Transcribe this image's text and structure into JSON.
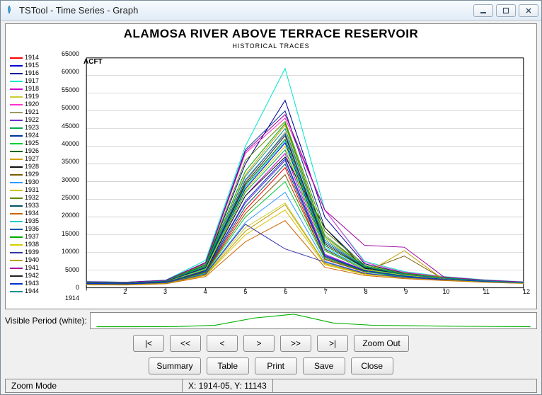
{
  "window": {
    "title": "TSTool - Time Series - Graph",
    "min_tip": "Minimize",
    "max_tip": "Restore",
    "close_tip": "Close"
  },
  "chart": {
    "title": "ALAMOSA RIVER ABOVE TERRACE RESERVOIR",
    "subtitle": "HISTORICAL TRACES",
    "y_unit": "ACFT",
    "origin_label": "1914",
    "ylim": [
      0,
      65000
    ],
    "xlim": [
      1,
      12
    ]
  },
  "y_ticks": [
    "65000",
    "60000",
    "55000",
    "50000",
    "45000",
    "40000",
    "35000",
    "30000",
    "25000",
    "20000",
    "15000",
    "10000",
    "5000",
    "0"
  ],
  "x_ticks": [
    "2",
    "3",
    "4",
    "5",
    "6",
    "7",
    "8",
    "9",
    "10",
    "11",
    "12"
  ],
  "legend": [
    {
      "label": "1914",
      "color": "#ff0000"
    },
    {
      "label": "1915",
      "color": "#0000cc"
    },
    {
      "label": "1916",
      "color": "#000099"
    },
    {
      "label": "1917",
      "color": "#00e6cc"
    },
    {
      "label": "1918",
      "color": "#cc00cc"
    },
    {
      "label": "1919",
      "color": "#cccc33"
    },
    {
      "label": "1920",
      "color": "#ff33cc"
    },
    {
      "label": "1921",
      "color": "#999966"
    },
    {
      "label": "1922",
      "color": "#6633cc"
    },
    {
      "label": "1923",
      "color": "#00aa55"
    },
    {
      "label": "1924",
      "color": "#003399"
    },
    {
      "label": "1925",
      "color": "#00cc33"
    },
    {
      "label": "1926",
      "color": "#006600"
    },
    {
      "label": "1927",
      "color": "#d4a000"
    },
    {
      "label": "1928",
      "color": "#111111"
    },
    {
      "label": "1929",
      "color": "#7a5c00"
    },
    {
      "label": "1930",
      "color": "#3399ff"
    },
    {
      "label": "1931",
      "color": "#d4c200"
    },
    {
      "label": "1932",
      "color": "#5c8a00"
    },
    {
      "label": "1933",
      "color": "#005566"
    },
    {
      "label": "1934",
      "color": "#cc6600"
    },
    {
      "label": "1935",
      "color": "#00d0d0"
    },
    {
      "label": "1936",
      "color": "#0055aa"
    },
    {
      "label": "1937",
      "color": "#00aa00"
    },
    {
      "label": "1938",
      "color": "#d0d000"
    },
    {
      "label": "1939",
      "color": "#3333aa"
    },
    {
      "label": "1940",
      "color": "#bca000"
    },
    {
      "label": "1941",
      "color": "#a000a0"
    },
    {
      "label": "1942",
      "color": "#222222"
    },
    {
      "label": "1943",
      "color": "#0033cc"
    },
    {
      "label": "1944",
      "color": "#009090"
    }
  ],
  "chart_data": {
    "type": "line",
    "xlabel": "",
    "ylabel": "ACFT",
    "xlim": [
      1,
      12
    ],
    "ylim": [
      0,
      65000
    ],
    "x": [
      1,
      2,
      3,
      4,
      5,
      6,
      7,
      8,
      9,
      10,
      11,
      12
    ],
    "series": [
      {
        "name": "1914",
        "values": [
          1200,
          1100,
          1500,
          4500,
          22000,
          34000,
          8000,
          4500,
          3200,
          2400,
          1800,
          1400
        ]
      },
      {
        "name": "1915",
        "values": [
          1400,
          1300,
          1700,
          5200,
          28000,
          41000,
          11000,
          5200,
          3600,
          2600,
          1900,
          1500
        ]
      },
      {
        "name": "1916",
        "values": [
          1600,
          1500,
          2000,
          6500,
          35000,
          53000,
          20000,
          6800,
          4200,
          3000,
          2100,
          1600
        ]
      },
      {
        "name": "1917",
        "values": [
          1800,
          1600,
          2200,
          7800,
          40000,
          62000,
          22000,
          7500,
          4600,
          3200,
          2300,
          1700
        ]
      },
      {
        "name": "1918",
        "values": [
          1300,
          1200,
          1600,
          5000,
          26000,
          38000,
          9500,
          5000,
          3400,
          2500,
          1850,
          1450
        ]
      },
      {
        "name": "1919",
        "values": [
          1000,
          950,
          1300,
          3800,
          17000,
          24000,
          7000,
          4000,
          2900,
          2200,
          1650,
          1300
        ]
      },
      {
        "name": "1920",
        "values": [
          1700,
          1550,
          2100,
          7000,
          38000,
          48000,
          22000,
          7200,
          4400,
          3100,
          2200,
          1650
        ]
      },
      {
        "name": "1921",
        "values": [
          1500,
          1400,
          1900,
          6000,
          30000,
          44000,
          15000,
          6000,
          3900,
          2800,
          2000,
          1550
        ]
      },
      {
        "name": "1922",
        "values": [
          1250,
          1150,
          1550,
          4800,
          24000,
          36000,
          9000,
          4800,
          3300,
          2450,
          1800,
          1420
        ]
      },
      {
        "name": "1923",
        "values": [
          1350,
          1250,
          1650,
          5100,
          27000,
          39000,
          10500,
          5100,
          3500,
          2550,
          1870,
          1470
        ]
      },
      {
        "name": "1924",
        "values": [
          1750,
          1600,
          2150,
          7200,
          39000,
          50000,
          17000,
          6200,
          3950,
          2850,
          2050,
          1580
        ]
      },
      {
        "name": "1925",
        "values": [
          1100,
          1000,
          1400,
          4200,
          20000,
          30000,
          8200,
          4600,
          3100,
          2350,
          1750,
          1370
        ]
      },
      {
        "name": "1926",
        "values": [
          1450,
          1350,
          1800,
          5600,
          29000,
          42000,
          12000,
          5600,
          3750,
          2700,
          1950,
          1520
        ]
      },
      {
        "name": "1927",
        "values": [
          1550,
          1450,
          1950,
          6200,
          32000,
          46000,
          14000,
          6100,
          3850,
          2750,
          1980,
          1540
        ]
      },
      {
        "name": "1928",
        "values": [
          1300,
          1200,
          1600,
          5000,
          26000,
          37000,
          17000,
          5500,
          3700,
          2650,
          1900,
          1480
        ]
      },
      {
        "name": "1929",
        "values": [
          1150,
          1050,
          1450,
          4400,
          21000,
          32000,
          8500,
          4700,
          9000,
          2400,
          1780,
          1400
        ]
      },
      {
        "name": "1930",
        "values": [
          1050,
          980,
          1350,
          4000,
          18500,
          27000,
          7500,
          4200,
          3000,
          2300,
          1700,
          1340
        ]
      },
      {
        "name": "1931",
        "values": [
          900,
          850,
          1200,
          3500,
          15000,
          22000,
          6500,
          3800,
          2800,
          2150,
          1620,
          1280
        ]
      },
      {
        "name": "1932",
        "values": [
          1650,
          1500,
          2050,
          6800,
          36000,
          47000,
          16000,
          6500,
          4100,
          2950,
          2120,
          1620
        ]
      },
      {
        "name": "1933",
        "values": [
          1200,
          1100,
          1500,
          4600,
          23000,
          35000,
          8800,
          4750,
          3250,
          2430,
          1810,
          1410
        ]
      },
      {
        "name": "1934",
        "values": [
          850,
          800,
          1150,
          3200,
          13000,
          19000,
          5800,
          3500,
          2600,
          2050,
          1560,
          1240
        ]
      },
      {
        "name": "1935",
        "values": [
          1400,
          1300,
          1750,
          5400,
          28500,
          41500,
          11500,
          5300,
          3650,
          2620,
          1910,
          1490
        ]
      },
      {
        "name": "1936",
        "values": [
          1500,
          1400,
          1850,
          5800,
          30500,
          43500,
          13000,
          5800,
          3800,
          2720,
          1970,
          1530
        ]
      },
      {
        "name": "1937",
        "values": [
          1600,
          1480,
          2000,
          6400,
          33000,
          46500,
          14500,
          6150,
          3880,
          2770,
          1990,
          1550
        ]
      },
      {
        "name": "1938",
        "values": [
          1350,
          1260,
          1680,
          5150,
          27500,
          40000,
          10800,
          5200,
          3550,
          2580,
          1890,
          1480
        ]
      },
      {
        "name": "1939",
        "values": [
          1020,
          960,
          1330,
          3900,
          18000,
          11000,
          7300,
          4100,
          2950,
          2280,
          1690,
          1330
        ]
      },
      {
        "name": "1940",
        "values": [
          950,
          900,
          1250,
          3600,
          16000,
          23500,
          6800,
          3900,
          10500,
          2200,
          1650,
          1300
        ]
      },
      {
        "name": "1941",
        "values": [
          1700,
          1560,
          2120,
          7100,
          38500,
          49000,
          22000,
          12000,
          11500,
          3080,
          2180,
          1640
        ]
      },
      {
        "name": "1942",
        "values": [
          1450,
          1360,
          1820,
          5700,
          29500,
          43000,
          12500,
          5700,
          3780,
          2710,
          1960,
          1525
        ]
      },
      {
        "name": "1943",
        "values": [
          1250,
          1160,
          1560,
          4850,
          24500,
          36500,
          9200,
          4850,
          3320,
          2460,
          1815,
          1425
        ]
      },
      {
        "name": "1944",
        "values": [
          1550,
          1440,
          1940,
          6150,
          31500,
          45000,
          13500,
          5950,
          3830,
          2740,
          1975,
          1535
        ]
      }
    ]
  },
  "vp_label": "Visible Period (white):",
  "nav_buttons": {
    "first": "|<",
    "fast_back": "<<",
    "back": "<",
    "fwd": ">",
    "fast_fwd": ">>",
    "last": ">|",
    "zoom_out": "Zoom Out"
  },
  "action_buttons": {
    "summary": "Summary",
    "table": "Table",
    "print": "Print",
    "save": "Save",
    "close": "Close"
  },
  "status": {
    "mode": "Zoom Mode",
    "coords": "X: 1914-05, Y: 11143"
  }
}
